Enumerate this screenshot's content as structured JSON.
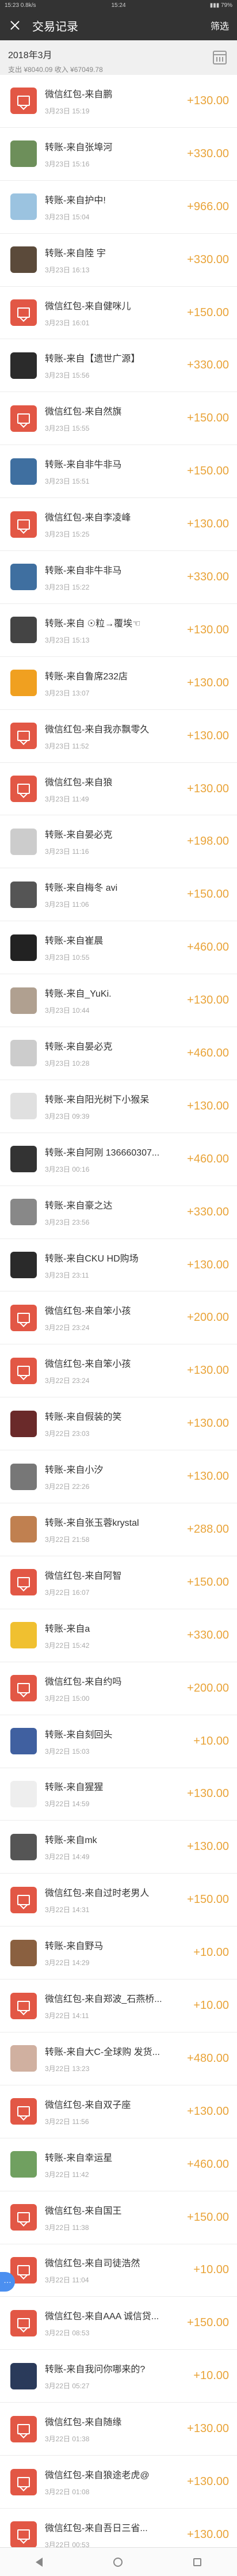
{
  "status_bar": {
    "left": "15:23 0.8k/s",
    "center": "15:24",
    "right": "▮▮▮ 79%"
  },
  "header": {
    "title": "交易记录",
    "filter_label": "筛选"
  },
  "month": {
    "title": "2018年3月",
    "summary": "支出 ¥8040.09 收入 ¥67049.78"
  },
  "transactions": [
    {
      "title": "微信红包-来自鹏",
      "time": "3月23日 15:19",
      "amount": "+130.00",
      "avatar": "red-packet"
    },
    {
      "title": "转账-来自张埠河",
      "time": "3月23日 15:16",
      "amount": "+330.00",
      "avatar": "photo",
      "color": "#6d8f5a"
    },
    {
      "title": "转账-来自护中!",
      "time": "3月23日 15:04",
      "amount": "+966.00",
      "avatar": "photo",
      "color": "#9bc3e0"
    },
    {
      "title": "转账-来自陸 宇",
      "time": "3月23日 16:13",
      "amount": "+330.00",
      "avatar": "photo",
      "color": "#5b4a3a"
    },
    {
      "title": "微信红包-来自健咪儿",
      "time": "3月23日 16:01",
      "amount": "+150.00",
      "avatar": "red-packet"
    },
    {
      "title": "转账-来自【遗世广源】",
      "time": "3月23日 15:56",
      "amount": "+330.00",
      "avatar": "photo",
      "color": "#2b2b2b"
    },
    {
      "title": "微信红包-来自然旗",
      "time": "3月23日 15:55",
      "amount": "+150.00",
      "avatar": "red-packet"
    },
    {
      "title": "转账-来自非牛非马",
      "time": "3月23日 15:51",
      "amount": "+150.00",
      "avatar": "photo",
      "color": "#3f6fa0"
    },
    {
      "title": "微信红包-来自李凌峰",
      "time": "3月23日 15:25",
      "amount": "+130.00",
      "avatar": "red-packet"
    },
    {
      "title": "转账-来自非牛非马",
      "time": "3月23日 15:22",
      "amount": "+330.00",
      "avatar": "photo",
      "color": "#3f6fa0"
    },
    {
      "title": "转账-来自 ☉粒→覆埃☜",
      "time": "3月23日 15:13",
      "amount": "+130.00",
      "avatar": "photo",
      "color": "#444444"
    },
    {
      "title": "转账-来自鲁席232店",
      "time": "3月23日 13:07",
      "amount": "+130.00",
      "avatar": "photo",
      "color": "#f0a020"
    },
    {
      "title": "微信红包-来自我亦飘零久",
      "time": "3月23日 11:52",
      "amount": "+130.00",
      "avatar": "red-packet"
    },
    {
      "title": "微信红包-来自狼",
      "time": "3月23日 11:49",
      "amount": "+130.00",
      "avatar": "red-packet"
    },
    {
      "title": "转账-来自晏必克",
      "time": "3月23日 11:16",
      "amount": "+198.00",
      "avatar": "photo",
      "color": "#cccccc"
    },
    {
      "title": "转账-来自梅冬 avi",
      "time": "3月23日 11:06",
      "amount": "+150.00",
      "avatar": "photo",
      "color": "#555555"
    },
    {
      "title": "转账-来自崔晨",
      "time": "3月23日 10:55",
      "amount": "+460.00",
      "avatar": "photo",
      "color": "#222222"
    },
    {
      "title": "转账-来自_YuKi.",
      "time": "3月23日 10:44",
      "amount": "+130.00",
      "avatar": "photo",
      "color": "#b0a090"
    },
    {
      "title": "转账-来自晏必克",
      "time": "3月23日 10:28",
      "amount": "+460.00",
      "avatar": "photo",
      "color": "#cccccc"
    },
    {
      "title": "转账-来自阳光树下小猴呆",
      "time": "3月23日 09:39",
      "amount": "+130.00",
      "avatar": "photo",
      "color": "#e0e0e0"
    },
    {
      "title": "转账-来自阿刚 136660307...",
      "time": "3月23日 00:16",
      "amount": "+460.00",
      "avatar": "photo",
      "color": "#333333"
    },
    {
      "title": "转账-来自豪之达",
      "time": "3月23日 23:56",
      "amount": "+330.00",
      "avatar": "photo",
      "color": "#888888"
    },
    {
      "title": "转账-来自CKU HD购场",
      "time": "3月23日 23:11",
      "amount": "+130.00",
      "avatar": "photo",
      "color": "#2a2a2a"
    },
    {
      "title": "微信红包-来自笨小孩",
      "time": "3月22日 23:24",
      "amount": "+200.00",
      "avatar": "red-packet"
    },
    {
      "title": "微信红包-来自笨小孩",
      "time": "3月22日 23:24",
      "amount": "+130.00",
      "avatar": "red-packet"
    },
    {
      "title": "转账-来自假装的笑",
      "time": "3月22日 23:03",
      "amount": "+130.00",
      "avatar": "photo",
      "color": "#6a2a2a"
    },
    {
      "title": "转账-来自小汐",
      "time": "3月22日 22:26",
      "amount": "+130.00",
      "avatar": "photo",
      "color": "#777777"
    },
    {
      "title": "转账-来自张玉蓉krystal",
      "time": "3月22日 21:58",
      "amount": "+288.00",
      "avatar": "photo",
      "color": "#c08050"
    },
    {
      "title": "微信红包-来自阿智",
      "time": "3月22日 16:07",
      "amount": "+150.00",
      "avatar": "red-packet"
    },
    {
      "title": "转账-来自a",
      "time": "3月22日 15:42",
      "amount": "+330.00",
      "avatar": "photo",
      "color": "#f0c030"
    },
    {
      "title": "微信红包-来自约吗",
      "time": "3月22日 15:00",
      "amount": "+200.00",
      "avatar": "red-packet"
    },
    {
      "title": "转账-来自刻回头",
      "time": "3月22日 15:03",
      "amount": "+10.00",
      "avatar": "photo",
      "color": "#4060a0"
    },
    {
      "title": "转账-来自猩猩",
      "time": "3月22日 14:59",
      "amount": "+130.00",
      "avatar": "photo",
      "color": "#eeeeee"
    },
    {
      "title": "转账-来自mk",
      "time": "3月22日 14:49",
      "amount": "+130.00",
      "avatar": "photo",
      "color": "#555555"
    },
    {
      "title": "微信红包-来自过时老男人",
      "time": "3月22日 14:31",
      "amount": "+150.00",
      "avatar": "red-packet"
    },
    {
      "title": "转账-来自野马",
      "time": "3月22日 14:29",
      "amount": "+10.00",
      "avatar": "photo",
      "color": "#8a6040"
    },
    {
      "title": "微信红包-来自郑波_石燕桥...",
      "time": "3月22日 14:11",
      "amount": "+10.00",
      "avatar": "red-packet"
    },
    {
      "title": "转账-来自大C-全球购 发货...",
      "time": "3月22日 13:23",
      "amount": "+480.00",
      "avatar": "photo",
      "color": "#d0b0a0"
    },
    {
      "title": "微信红包-来自双子座",
      "time": "3月22日 11:56",
      "amount": "+130.00",
      "avatar": "red-packet"
    },
    {
      "title": "转账-来自幸运星",
      "time": "3月22日 11:42",
      "amount": "+460.00",
      "avatar": "photo",
      "color": "#70a060"
    },
    {
      "title": "微信红包-来自国王",
      "time": "3月22日 11:38",
      "amount": "+150.00",
      "avatar": "red-packet"
    },
    {
      "title": "微信红包-来自司徒浩然",
      "time": "3月22日 11:04",
      "amount": "+10.00",
      "avatar": "red-packet"
    },
    {
      "title": "微信红包-来自AAA 诚信贷...",
      "time": "3月22日 08:53",
      "amount": "+150.00",
      "avatar": "red-packet"
    },
    {
      "title": "转账-来自我问你哪来的?",
      "time": "3月22日 05:27",
      "amount": "+10.00",
      "avatar": "photo",
      "color": "#2a3a5a"
    },
    {
      "title": "微信红包-来自随缘",
      "time": "3月22日 01:38",
      "amount": "+130.00",
      "avatar": "red-packet"
    },
    {
      "title": "微信红包-来自狼途老虎@",
      "time": "3月22日 01:08",
      "amount": "+130.00",
      "avatar": "red-packet"
    },
    {
      "title": "微信红包-来自吾日三省...",
      "time": "3月22日 00:53",
      "amount": "+130.00",
      "avatar": "red-packet"
    }
  ],
  "colors": {
    "amount": "#e9a43a",
    "header_bg": "#333333",
    "red_packet": "#e25745"
  }
}
